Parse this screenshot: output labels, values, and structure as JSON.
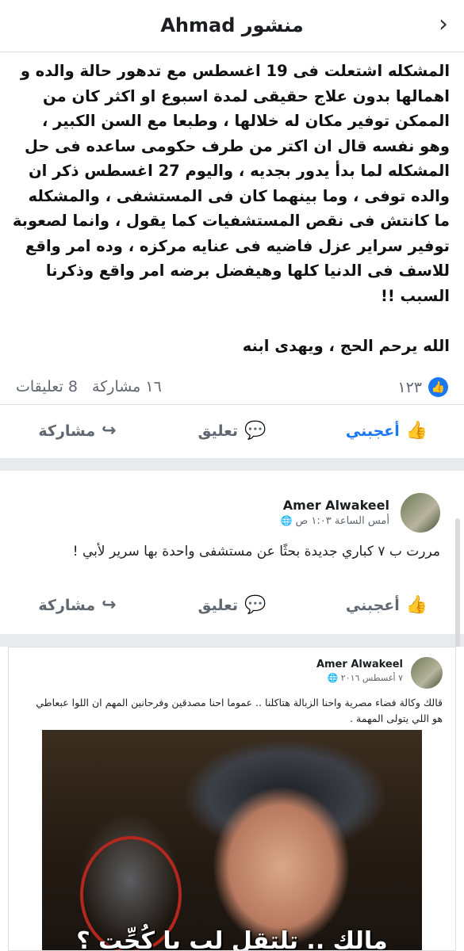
{
  "header": {
    "title": "منشور Ahmad",
    "back_icon": "chevron-right-icon"
  },
  "post": {
    "text": "المشكله اشتعلت  فى 19 اغسطس مع تدهور حالة والده و اهمالها بدون علاج حقيقى لمدة اسبوع او اكثر كان من الممكن توفير مكان له خلالها  ، وطبعا مع السن الكبير ، وهو نفسه قال ان اكتر من طرف حكومى ساعده فى حل المشكله لما بدأ يدور بجديه ، واليوم 27 اغسطس ذكر ان والده توفى ، وما بينهما كان فى المستشفى ، والمشكله ما كانتش فى نقص المستشفيات كما يقول ، وانما لصعوبة توفير سراير عزل فاضيه فى عنايه مركزه ، وده امر واقع للاسف فى الدنيا كلها وهيفضل برضه امر واقع وذكرنا السبب !!\n\nالله يرحم الحج ، ويهدى ابنه",
    "reactions_count": "١٢٣",
    "comments_count": "8 تعليقات",
    "shares_count": "١٦ مشاركة",
    "actions": {
      "like": "أعجبني",
      "comment": "تعليق",
      "share": "مشاركة"
    }
  },
  "comment": {
    "author": "Amer Alwakeel",
    "time": "أمس الساعة ١:٠٣ ص",
    "text": "مررت ب ٧ كباري جديدة بحثًا عن مستشفى واحدة بها سرير لأبي !",
    "actions": {
      "like": "أعجبني",
      "comment": "تعليق",
      "share": "مشاركة"
    }
  },
  "shared_post": {
    "author": "Amer Alwakeel",
    "time": "٧ أغسطس ٢٠١٦",
    "text": "قالك وكالة فضاء مصرية واحنا الزبالة هتاكلنا .. عموما احنا مصدقين وفرحانين المهم ان اللوا عبعاطي\nهو اللي يتولى المهمة .",
    "meme_caption": "مالك .. تلتقل لب يا كُحِّت ؟"
  }
}
